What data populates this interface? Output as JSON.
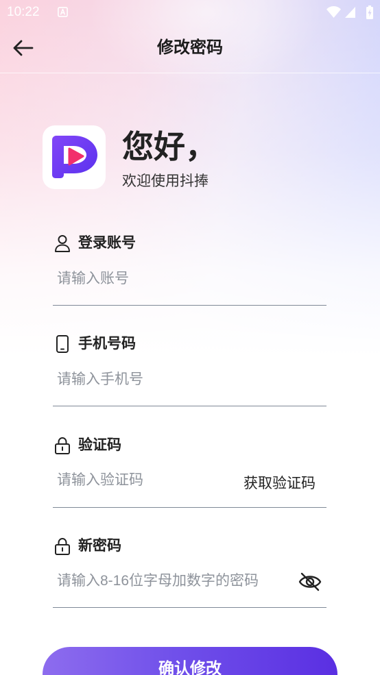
{
  "status_bar": {
    "time": "10:22",
    "icons": [
      "notification-a-icon",
      "wifi-icon",
      "cellular-signal-icon",
      "battery-charging-icon"
    ]
  },
  "header": {
    "back_icon": "arrow-left-icon",
    "title": "修改密码"
  },
  "welcome": {
    "logo_icon": "app-logo-icon",
    "greeting": "您好，",
    "subtitle": "欢迎使用抖捧"
  },
  "form": {
    "account": {
      "icon": "user-icon",
      "label": "登录账号",
      "placeholder": "请输入账号"
    },
    "phone": {
      "icon": "phone-icon",
      "label": "手机号码",
      "placeholder": "请输入手机号"
    },
    "code": {
      "icon": "lock-icon",
      "label": "验证码",
      "placeholder": "请输入验证码",
      "get_code_label": "获取验证码"
    },
    "new_password": {
      "icon": "lock-icon",
      "label": "新密码",
      "placeholder": "请输入8-16位字母加数字的密码",
      "visibility_icon": "eye-off-icon"
    }
  },
  "submit": {
    "label": "确认修改"
  },
  "colors": {
    "accent": "#6a3cf2",
    "logo_play": "#f2306c",
    "button_start": "#8d6cee",
    "button_end": "#5a2fe2",
    "placeholder": "#8e939b",
    "divider": "#7e8896",
    "status_bar_text": "#ffffff"
  }
}
